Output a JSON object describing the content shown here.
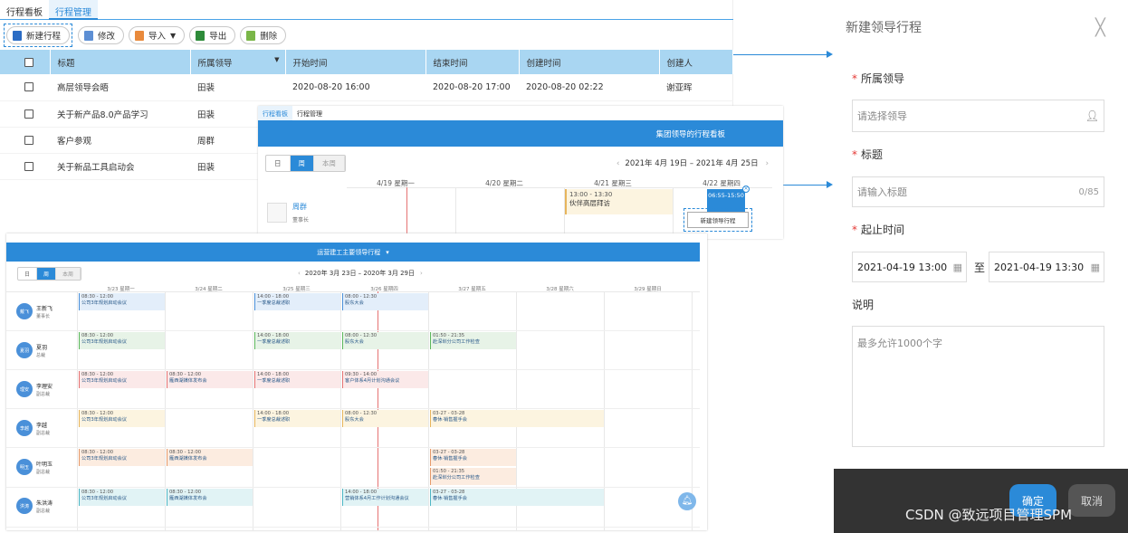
{
  "list_view": {
    "tabs": [
      "行程看板",
      "行程管理"
    ],
    "active_tab": 1,
    "toolbar": {
      "new": "新建行程",
      "edit": "修改",
      "import": "导入",
      "export": "导出",
      "delete": "删除"
    },
    "columns": [
      "标题",
      "所属领导",
      "开始时间",
      "结束时间",
      "创建时间",
      "创建人"
    ],
    "rows": [
      {
        "title": "高层领导会晤",
        "leader": "田裴",
        "start": "2020-08-20 16:00",
        "end": "2020-08-20 17:00",
        "created": "2020-08-20 02:22",
        "creator": "谢亚晖"
      },
      {
        "title": "关于新产品8.0产品学习",
        "leader": "田裴"
      },
      {
        "title": "客户参观",
        "leader": "周群"
      },
      {
        "title": "关于新品工具启动会",
        "leader": "田裴"
      }
    ]
  },
  "week_board": {
    "tabs": [
      "行程看板",
      "行程管理"
    ],
    "banner": "集团领导的行程看板",
    "views": [
      "日",
      "周",
      "本周"
    ],
    "date_range": "2021年 4月 19日 – 2021年 4月 25日",
    "days": [
      "4/19 星期一",
      "4/20 星期二",
      "4/21 星期三",
      "4/22 星期四"
    ],
    "leader": {
      "name": "周群",
      "title": "董事长"
    },
    "event": {
      "time": "13:00 - 13:30",
      "title": "伙伴高层拜访"
    },
    "popup_time": "06:55-15:50",
    "new_button": "新建领导行程"
  },
  "multi_board": {
    "banner": "运营建工主要领导行程",
    "views": [
      "日",
      "周",
      "本周"
    ],
    "date_range": "2020年 3月 23日 – 2020年 3月 29日",
    "days": [
      "3/23 星期一",
      "3/24 星期二",
      "3/25 星期三",
      "3/26 星期四",
      "3/27 星期五",
      "3/28 星期六",
      "3/29 星期日"
    ],
    "leaders": [
      {
        "avatar": "戴飞",
        "name": "王新飞",
        "title": "董事长"
      },
      {
        "avatar": "夏羽",
        "name": "夏羽",
        "title": "总裁"
      },
      {
        "avatar": "理安",
        "name": "李理安",
        "title": "副总裁"
      },
      {
        "avatar": "李越",
        "name": "李越",
        "title": "副总裁"
      },
      {
        "avatar": "明玉",
        "name": "叶明玉",
        "title": "副总裁"
      },
      {
        "avatar": "洪涛",
        "name": "朱洪涛",
        "title": "副总裁"
      }
    ],
    "events": {
      "e_0800_1200": "08:30 - 12:00",
      "kickoff": "公司3年规划启动会议",
      "t1400": "14:00 - 18:00",
      "report": "一季度总裁述职",
      "t0800_1230": "08:00 - 12:30",
      "shareholder": "股东大会",
      "t0150": "01:50 - 21:35",
      "shenzhen": "赴深圳分公司工作检查",
      "media": "雁西湖媒体发布会",
      "t0930": "09:30 - 14:00",
      "client_plan": "客户体系4月计划沟通会议",
      "t0327": "03-27 - 03-28",
      "spring": "春休·销售握手会",
      "sales_plan": "营销体系4月工作计划沟通会议"
    }
  },
  "form": {
    "title": "新建领导行程",
    "close": "╳",
    "leader_label": "所属领导",
    "leader_placeholder": "请选择领导",
    "title_label": "标题",
    "title_placeholder": "请输入标题",
    "title_count": "0/85",
    "time_label": "起止时间",
    "start": "2021-04-19 13:00",
    "to": "至",
    "end": "2021-04-19 13:30",
    "desc_label": "说明",
    "desc_placeholder": "最多允许1000个字",
    "ok": "确定",
    "cancel": "取消"
  },
  "watermark": "CSDN @致远项目管理SPM"
}
